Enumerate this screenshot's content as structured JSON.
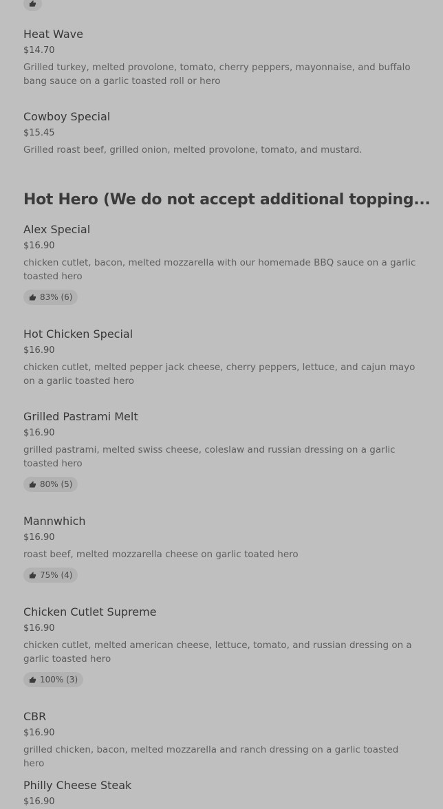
{
  "section": {
    "title": "Hot Hero (We do not accept additional topping..."
  },
  "top_items": [
    {
      "name": "Heat Wave",
      "price": "$14.70",
      "description": "Grilled turkey, melted provolone, tomato, cherry peppers, mayonnaise, and buffalo bang sauce on a garlic toasted roll or hero"
    },
    {
      "name": "Cowboy Special",
      "price": "$15.45",
      "description": "Grilled roast beef, grilled onion, melted provolone, tomato, and mustard."
    }
  ],
  "items": [
    {
      "name": "Alex Special",
      "price": "$16.90",
      "description": "chicken cutlet, bacon, melted mozzarella with our homemade BBQ sauce on a garlic toasted hero",
      "rating": "83% (6)"
    },
    {
      "name": "Hot Chicken Special",
      "price": "$16.90",
      "description": "chicken cutlet, melted pepper jack cheese, cherry peppers, lettuce, and cajun mayo on a garlic toasted hero"
    },
    {
      "name": "Grilled Pastrami Melt",
      "price": "$16.90",
      "description": "grilled pastrami, melted swiss cheese, coleslaw and russian dressing on a garlic toasted hero",
      "rating": "80% (5)"
    },
    {
      "name": "Mannwhich",
      "price": "$16.90",
      "description": "roast beef, melted mozzarella cheese on garlic toated hero",
      "rating": "75% (4)"
    },
    {
      "name": "Chicken Cutlet Supreme",
      "price": "$16.90",
      "description": "chicken cutlet, melted american cheese, lettuce, tomato, and russian dressing on a garlic toasted hero",
      "rating": "100% (3)"
    },
    {
      "name": "CBR",
      "price": "$16.90",
      "description": "grilled chicken, bacon, melted mozzarella and ranch dressing on a garlic toasted hero"
    },
    {
      "name": "Philly Cheese Steak",
      "price": "$16.90"
    }
  ],
  "icons": {
    "rating": "thumbs-up-icon"
  }
}
